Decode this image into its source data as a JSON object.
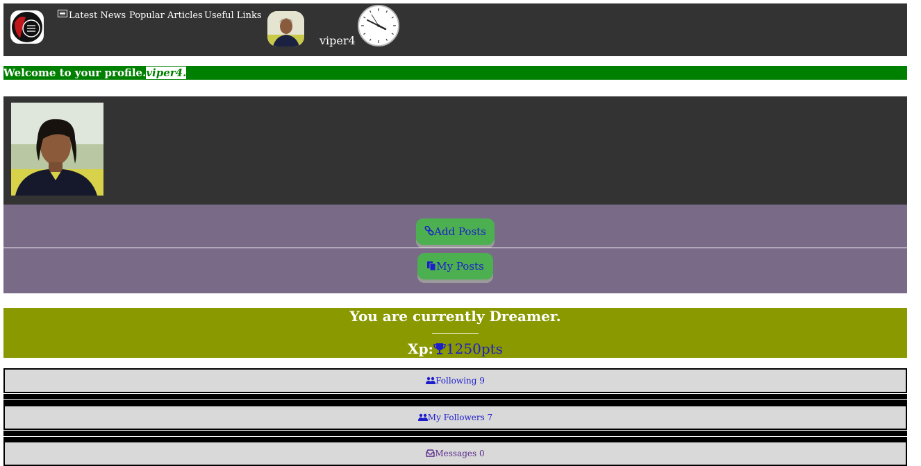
{
  "header": {
    "nav": [
      {
        "label": "Latest News",
        "icon": "newspaper-icon"
      },
      {
        "label": "Popular Articles"
      },
      {
        "label": "Useful Links"
      }
    ],
    "username": "viper4"
  },
  "welcome": {
    "text": "Welcome to your profile.",
    "name": "viper4."
  },
  "actions": [
    {
      "label": "Add Posts",
      "icon": "link-icon"
    },
    {
      "label": "My Posts",
      "icon": "copy-icon"
    }
  ],
  "rank": {
    "title": "You are currently Dreamer.",
    "xp_label": "Xp:",
    "xp_value": "1250pts",
    "icon": "trophy-icon"
  },
  "stats": [
    {
      "label": "Following 9",
      "icon": "users-icon"
    },
    {
      "label": "My Followers 7",
      "icon": "users-icon"
    },
    {
      "label": "Messages 0",
      "icon": "inbox-icon"
    }
  ],
  "colors": {
    "header_bg": "#333333",
    "welcome_bg": "#008000",
    "actions_bg": "#796a88",
    "button_bg": "#4caf50",
    "rank_bg": "#8a9900",
    "link": "#1d1dcc"
  }
}
